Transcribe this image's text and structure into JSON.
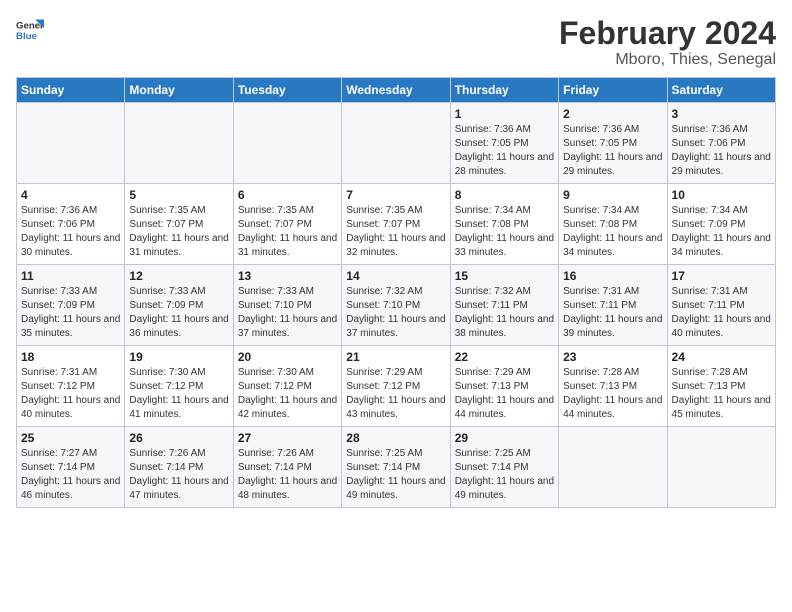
{
  "logo": {
    "line1": "General",
    "line2": "Blue"
  },
  "title": "February 2024",
  "subtitle": "Mboro, Thies, Senegal",
  "days": [
    "Sunday",
    "Monday",
    "Tuesday",
    "Wednesday",
    "Thursday",
    "Friday",
    "Saturday"
  ],
  "weeks": [
    [
      {
        "num": "",
        "info": ""
      },
      {
        "num": "",
        "info": ""
      },
      {
        "num": "",
        "info": ""
      },
      {
        "num": "",
        "info": ""
      },
      {
        "num": "1",
        "info": "Sunrise: 7:36 AM\nSunset: 7:05 PM\nDaylight: 11 hours and 28 minutes."
      },
      {
        "num": "2",
        "info": "Sunrise: 7:36 AM\nSunset: 7:05 PM\nDaylight: 11 hours and 29 minutes."
      },
      {
        "num": "3",
        "info": "Sunrise: 7:36 AM\nSunset: 7:06 PM\nDaylight: 11 hours and 29 minutes."
      }
    ],
    [
      {
        "num": "4",
        "info": "Sunrise: 7:36 AM\nSunset: 7:06 PM\nDaylight: 11 hours and 30 minutes."
      },
      {
        "num": "5",
        "info": "Sunrise: 7:35 AM\nSunset: 7:07 PM\nDaylight: 11 hours and 31 minutes."
      },
      {
        "num": "6",
        "info": "Sunrise: 7:35 AM\nSunset: 7:07 PM\nDaylight: 11 hours and 31 minutes."
      },
      {
        "num": "7",
        "info": "Sunrise: 7:35 AM\nSunset: 7:07 PM\nDaylight: 11 hours and 32 minutes."
      },
      {
        "num": "8",
        "info": "Sunrise: 7:34 AM\nSunset: 7:08 PM\nDaylight: 11 hours and 33 minutes."
      },
      {
        "num": "9",
        "info": "Sunrise: 7:34 AM\nSunset: 7:08 PM\nDaylight: 11 hours and 34 minutes."
      },
      {
        "num": "10",
        "info": "Sunrise: 7:34 AM\nSunset: 7:09 PM\nDaylight: 11 hours and 34 minutes."
      }
    ],
    [
      {
        "num": "11",
        "info": "Sunrise: 7:33 AM\nSunset: 7:09 PM\nDaylight: 11 hours and 35 minutes."
      },
      {
        "num": "12",
        "info": "Sunrise: 7:33 AM\nSunset: 7:09 PM\nDaylight: 11 hours and 36 minutes."
      },
      {
        "num": "13",
        "info": "Sunrise: 7:33 AM\nSunset: 7:10 PM\nDaylight: 11 hours and 37 minutes."
      },
      {
        "num": "14",
        "info": "Sunrise: 7:32 AM\nSunset: 7:10 PM\nDaylight: 11 hours and 37 minutes."
      },
      {
        "num": "15",
        "info": "Sunrise: 7:32 AM\nSunset: 7:11 PM\nDaylight: 11 hours and 38 minutes."
      },
      {
        "num": "16",
        "info": "Sunrise: 7:31 AM\nSunset: 7:11 PM\nDaylight: 11 hours and 39 minutes."
      },
      {
        "num": "17",
        "info": "Sunrise: 7:31 AM\nSunset: 7:11 PM\nDaylight: 11 hours and 40 minutes."
      }
    ],
    [
      {
        "num": "18",
        "info": "Sunrise: 7:31 AM\nSunset: 7:12 PM\nDaylight: 11 hours and 40 minutes."
      },
      {
        "num": "19",
        "info": "Sunrise: 7:30 AM\nSunset: 7:12 PM\nDaylight: 11 hours and 41 minutes."
      },
      {
        "num": "20",
        "info": "Sunrise: 7:30 AM\nSunset: 7:12 PM\nDaylight: 11 hours and 42 minutes."
      },
      {
        "num": "21",
        "info": "Sunrise: 7:29 AM\nSunset: 7:12 PM\nDaylight: 11 hours and 43 minutes."
      },
      {
        "num": "22",
        "info": "Sunrise: 7:29 AM\nSunset: 7:13 PM\nDaylight: 11 hours and 44 minutes."
      },
      {
        "num": "23",
        "info": "Sunrise: 7:28 AM\nSunset: 7:13 PM\nDaylight: 11 hours and 44 minutes."
      },
      {
        "num": "24",
        "info": "Sunrise: 7:28 AM\nSunset: 7:13 PM\nDaylight: 11 hours and 45 minutes."
      }
    ],
    [
      {
        "num": "25",
        "info": "Sunrise: 7:27 AM\nSunset: 7:14 PM\nDaylight: 11 hours and 46 minutes."
      },
      {
        "num": "26",
        "info": "Sunrise: 7:26 AM\nSunset: 7:14 PM\nDaylight: 11 hours and 47 minutes."
      },
      {
        "num": "27",
        "info": "Sunrise: 7:26 AM\nSunset: 7:14 PM\nDaylight: 11 hours and 48 minutes."
      },
      {
        "num": "28",
        "info": "Sunrise: 7:25 AM\nSunset: 7:14 PM\nDaylight: 11 hours and 49 minutes."
      },
      {
        "num": "29",
        "info": "Sunrise: 7:25 AM\nSunset: 7:14 PM\nDaylight: 11 hours and 49 minutes."
      },
      {
        "num": "",
        "info": ""
      },
      {
        "num": "",
        "info": ""
      }
    ]
  ]
}
